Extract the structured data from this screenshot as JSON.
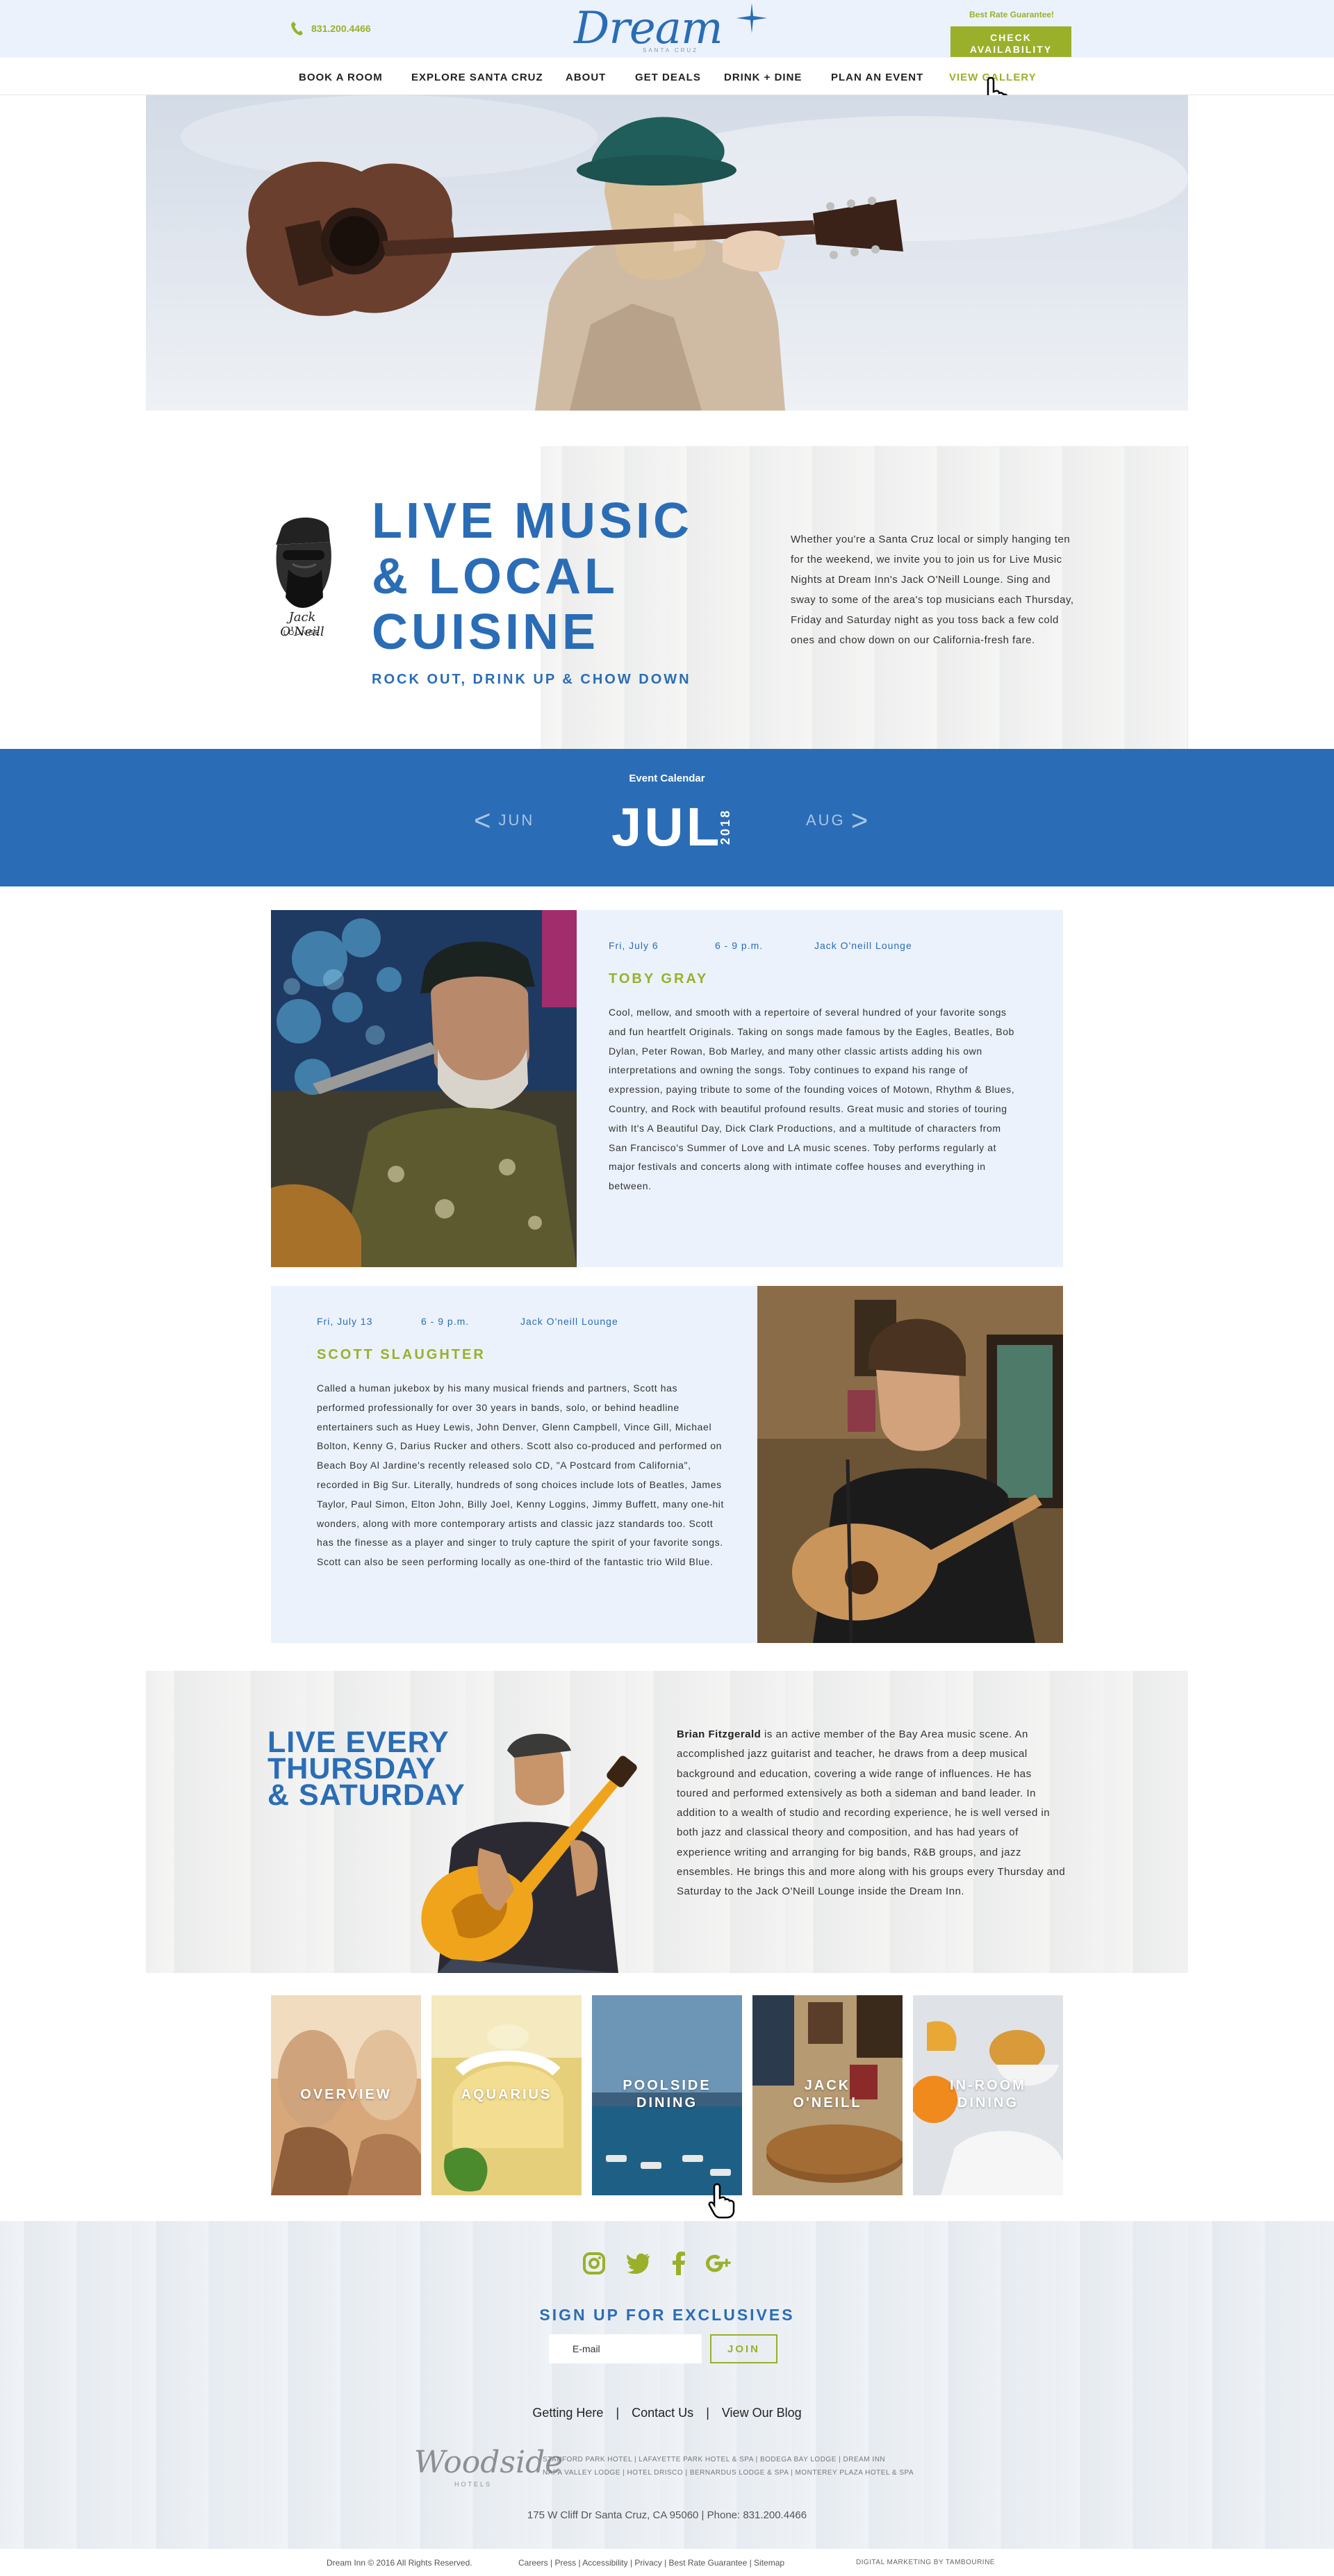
{
  "header": {
    "phone": "831.200.4466",
    "logo_text": "Dream Inn",
    "logo_sub": "SANTA CRUZ",
    "best_rate": "Best Rate Guarantee!",
    "check_line1": "CHECK",
    "check_line2": "AVAILABILITY"
  },
  "nav": {
    "items": [
      "BOOK A ROOM",
      "EXPLORE SANTA CRUZ",
      "ABOUT",
      "GET DEALS",
      "DRINK + DINE",
      "PLAN AN EVENT",
      "VIEW GALLERY"
    ],
    "active_index": 6
  },
  "intro": {
    "title_line1": "LIVE MUSIC",
    "title_line2": "& LOCAL",
    "title_line3": "CUISINE",
    "tagline": "ROCK OUT, DRINK UP & CHOW DOWN",
    "logo_script": "Jack O'Neill",
    "logo_sub": "LOUNGE",
    "text": "Whether you're a Santa Cruz local or simply hanging ten for the weekend, we invite you to join us for Live Music Nights at Dream Inn's Jack O'Neill Lounge. Sing and sway to some of the area's top musicians each Thursday, Friday and Saturday night as you toss back a few cold ones and chow down on our California-fresh fare."
  },
  "calendar": {
    "label": "Event Calendar",
    "prev": "JUN",
    "month": "JUL",
    "year": "2018",
    "next": "AUG"
  },
  "events": [
    {
      "date": "Fri, July 6",
      "time": "6 - 9 p.m.",
      "venue": "Jack O'neill Lounge",
      "name": "TOBY GRAY",
      "bio": "Cool, mellow, and smooth with a repertoire of several hundred of your favorite songs and fun heartfelt Originals. Taking on songs made famous by the Eagles, Beatles, Bob Dylan, Peter Rowan, Bob Marley, and many other classic artists adding his own interpretations and owning the songs. Toby continues to expand his range of expression, paying tribute to some of the founding voices of Motown, Rhythm & Blues, Country, and Rock with beautiful profound results. Great music and stories of touring with It's A Beautiful Day, Dick Clark Productions, and a multitude of characters from San Francisco's Summer of Love and LA music scenes. Toby performs regularly at major festivals and concerts along with intimate coffee houses and everything in between."
    },
    {
      "date": "Fri, July 13",
      "time": "6 - 9 p.m.",
      "venue": "Jack O'neill Lounge",
      "name": "SCOTT SLAUGHTER",
      "bio": "Called a human jukebox by his many musical friends and partners, Scott has performed professionally for over 30 years in bands, solo, or behind headline entertainers such as Huey Lewis, John Denver, Glenn Campbell, Vince Gill, Michael Bolton, Kenny G, Darius Rucker and others. Scott also co-produced and performed on Beach Boy Al Jardine's recently released solo CD, \"A Postcard from California\", recorded in Big Sur. Literally, hundreds of song choices include lots of Beatles, James Taylor, Paul Simon, Elton John, Billy Joel, Kenny Loggins, Jimmy Buffett, many one-hit wonders, along with more contemporary artists and classic jazz standards too. Scott has the finesse as a player and singer to truly capture the spirit of your favorite songs. Scott can also be seen performing locally as one-third of the fantastic trio Wild Blue."
    }
  ],
  "feature": {
    "title_line1": "LIVE EVERY",
    "title_line2": "THURSDAY",
    "title_line3": "& SATURDAY",
    "performer": "Brian Fitzgerald",
    "text": " is an active member of the Bay Area music scene. An accomplished jazz guitarist and teacher, he draws from a deep musical background and education, covering a wide range of influences. He has toured and performed extensively as both a sideman and band leader. In addition to a wealth of studio and recording experience, he is well versed in both jazz and classical theory and composition, and has had years of experience writing and arranging for big bands, R&B groups, and jazz ensembles. He brings this and more along with his groups every Thursday and Saturday to the Jack O'Neill Lounge inside the Dream Inn."
  },
  "tiles": [
    {
      "line1": "OVERVIEW",
      "line2": ""
    },
    {
      "line1": "AQUARIUS",
      "line2": ""
    },
    {
      "line1": "POOLSIDE",
      "line2": "DINING"
    },
    {
      "line1": "JACK",
      "line2": "O'NEILL"
    },
    {
      "line1": "IN-ROOM",
      "line2": "DINING"
    }
  ],
  "footer": {
    "signup_title": "SIGN UP FOR EXCLUSIVES",
    "email_placeholder": "E-mail",
    "join_label": "JOIN",
    "links": [
      "Getting Here",
      "Contact Us",
      "View Our Blog"
    ],
    "brand": "Woodside",
    "brand_sub": "HOTELS",
    "hotels_line1": "STANFORD PARK HOTEL | LAFAYETTE PARK HOTEL & SPA | BODEGA BAY LODGE | DREAM INN",
    "hotels_line2": "NAPA VALLEY LODGE | HOTEL DRISCO | BERNARDUS LODGE & SPA | MONTEREY PLAZA HOTEL & SPA",
    "address": "175 W Cliff Dr Santa Cruz, CA 95060 | Phone: 831.200.4466",
    "copyright": "Dream Inn © 2016 All Rights Reserved.",
    "legal": "Careers | Press | Accessibility | Privacy | Best Rate Guarantee | Sitemap",
    "agency": "DIGITAL MARKETING BY TAMBOURINE"
  },
  "colors": {
    "brand_blue": "#2a6db6",
    "accent_green": "#9ab02a",
    "light_blue_bg": "#ebf2fb"
  },
  "icons": [
    "phone-icon",
    "star-icon",
    "instagram-icon",
    "twitter-icon",
    "facebook-icon",
    "google-plus-icon",
    "pointer-cursor-icon"
  ]
}
